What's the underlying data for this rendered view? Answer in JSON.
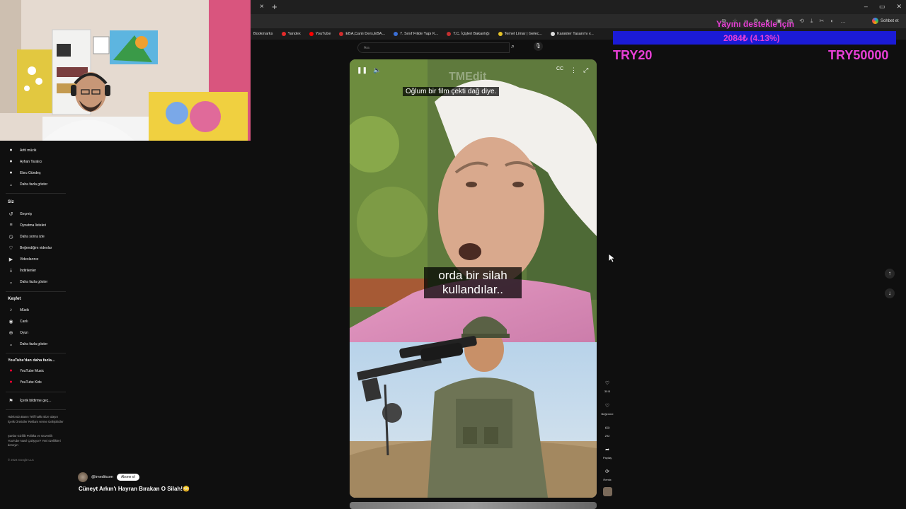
{
  "browser": {
    "tab_close": "×",
    "tab_new": "+",
    "window_controls": [
      "–",
      "▭",
      "✕"
    ],
    "chat_label": "Sohbet et",
    "bookmarks": [
      {
        "label": "Bookmarks",
        "color": "#999999"
      },
      {
        "label": "Yandex",
        "color": "#e52b2b"
      },
      {
        "label": "YouTube",
        "color": "#ff0000"
      },
      {
        "label": "EBA,Canlı Ders,EBA...",
        "color": "#d22d2d"
      },
      {
        "label": "7. Sınıf Fiilde Yapı K...",
        "color": "#3b6fd6"
      },
      {
        "label": "T.C. İçişleri Bakanlığı",
        "color": "#c43030"
      },
      {
        "label": "Temel Limar | Gelec...",
        "color": "#e6c328"
      },
      {
        "label": "Karakter Tasarımı v...",
        "color": "#dddddd"
      }
    ]
  },
  "sidebar": {
    "subscriptions": [
      {
        "label": "Artti müzik",
        "icon": "avatar-icon"
      },
      {
        "label": "Ayhan Taralıcı",
        "icon": "avatar-icon"
      },
      {
        "label": "Ebru Gündeş",
        "icon": "avatar-icon"
      },
      {
        "label": "Daha fazla göster",
        "icon": "chevron-down-icon"
      }
    ],
    "you_title": "Siz",
    "you_items": [
      {
        "label": "Geçmiş",
        "icon": "history-icon",
        "glyph": "↺"
      },
      {
        "label": "Oynatma listeleri",
        "icon": "playlist-icon",
        "glyph": "≡"
      },
      {
        "label": "Daha sonra izle",
        "icon": "clock-icon",
        "glyph": "◷"
      },
      {
        "label": "Beğendiğim videolar",
        "icon": "like-icon",
        "glyph": "👍"
      },
      {
        "label": "Videolarınız",
        "icon": "video-icon",
        "glyph": "▶"
      },
      {
        "label": "İndirilenler",
        "icon": "download-icon",
        "glyph": "⤓"
      },
      {
        "label": "Daha fazla göster",
        "icon": "chevron-down-icon",
        "glyph": "⌄"
      }
    ],
    "explore_title": "Keşfet",
    "explore_items": [
      {
        "label": "Müzik",
        "icon": "music-icon",
        "glyph": "♪"
      },
      {
        "label": "Canlı",
        "icon": "live-icon",
        "glyph": "◉"
      },
      {
        "label": "Oyun",
        "icon": "gaming-icon",
        "glyph": "🎮"
      },
      {
        "label": "Daha fazla göster",
        "icon": "chevron-down-icon",
        "glyph": "⌄"
      }
    ],
    "more_title": "YouTube'dan daha fazla...",
    "more_items": [
      {
        "label": "YouTube Music",
        "icon": "youtube-music-icon"
      },
      {
        "label": "YouTube Kids",
        "icon": "youtube-kids-icon"
      }
    ],
    "report_label": "İçerik bildirme geç...",
    "footer_1": "Hakkında Basın Telif hakkı Bize ulaşın İçerik Üreticiler Reklam verme Geliştiriciler",
    "footer_2": "Şartlar Gizlilik Politika ve Güvenlik YouTube Nasıl Çalışıyor? Yeni özellikleri deneyin",
    "copyright": "© 2024 Google LLC"
  },
  "search": {
    "placeholder": "Ara"
  },
  "video": {
    "watermark": "TMEdit",
    "caption_top": "Oğlum bir film çekti dağ diye.",
    "caption_mid": "orda bir silah kullandılar.."
  },
  "actions": {
    "likes": "30 B",
    "dislike_label": "Beğenme",
    "comments": "292",
    "share_label": "Paylaş",
    "remix_label": "Remix"
  },
  "channel": {
    "handle": "@tmeditcom",
    "subscribe_label": "Abone ol",
    "title": "Cüneyt Arkın'ı Hayran Bırakan O Silah!😳"
  },
  "overlay": {
    "donate_top": "Yayını destekle için",
    "donate_progress": "2084₺ (4.13%)",
    "min_amount": "TRY20",
    "max_amount": "TRY50000",
    "accent": "#e83fd6",
    "bar_color": "#1b1bd6"
  }
}
